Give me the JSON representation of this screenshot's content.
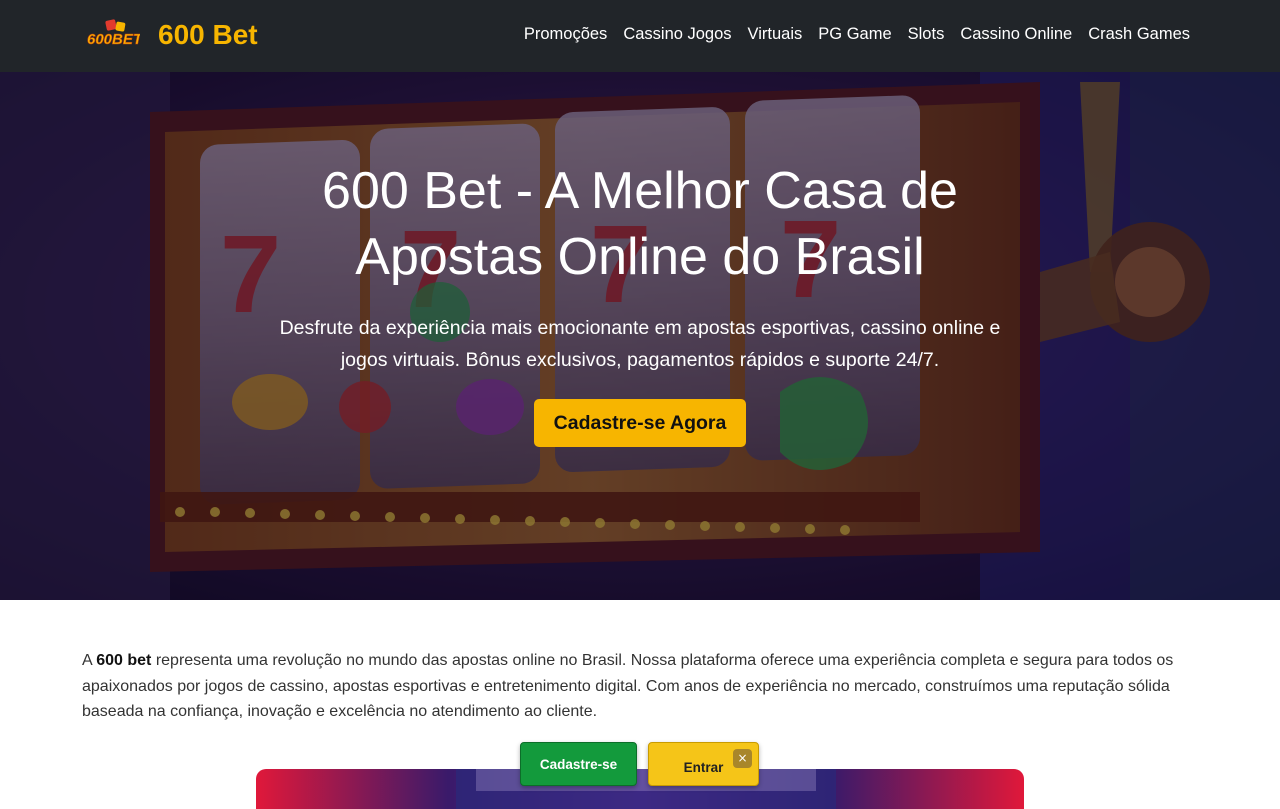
{
  "header": {
    "brand": "600 Bet",
    "logo_text": "600BET",
    "nav": [
      {
        "label": "Promoções"
      },
      {
        "label": "Cassino Jogos"
      },
      {
        "label": "Virtuais"
      },
      {
        "label": "PG Game"
      },
      {
        "label": "Slots"
      },
      {
        "label": "Cassino Online"
      },
      {
        "label": "Crash Games"
      }
    ]
  },
  "hero": {
    "title": "600 Bet - A Melhor Casa de Apostas Online do Brasil",
    "subtitle": "Desfrute da experiência mais emocionante em apostas esportivas, cassino online e jogos virtuais. Bônus exclusivos, pagamentos rápidos e suporte 24/7.",
    "cta_label": "Cadastre-se Agora"
  },
  "intro": {
    "prefix": "A ",
    "brand_bold": "600 bet",
    "text": " representa uma revolução no mundo das apostas online no Brasil. Nossa plataforma oferece uma experiência completa e segura para todos os apaixonados por jogos de cassino, apostas esportivas e entretenimento digital. Com anos de experiência no mercado, construímos uma reputação sólida baseada na confiança, inovação e excelência no atendimento ao cliente."
  },
  "floating": {
    "register_label": "Cadastre-se",
    "login_label": "Entrar",
    "close_label": "×"
  },
  "colors": {
    "header_bg": "#212529",
    "brand": "#f7b500",
    "cta_bg": "#f7b500",
    "register_bg": "#139a3c",
    "login_bg": "#f5c518"
  }
}
